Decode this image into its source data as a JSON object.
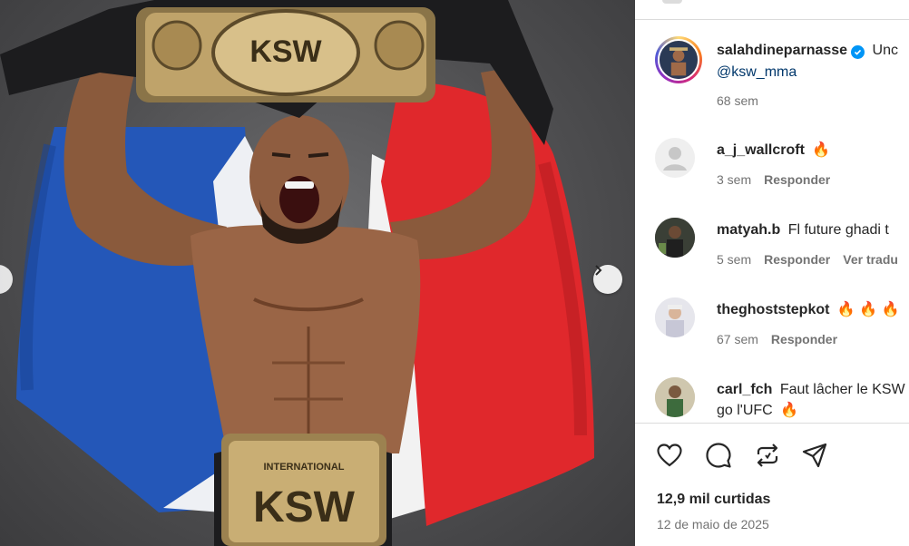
{
  "post": {
    "image_alt_icon": "fighter-with-championship-belt-photo",
    "belt_text_top": "KSW",
    "belt_text_bottom": "KSW",
    "belt_label_small": "INTERNATIONAL",
    "brand_color": "#0095f6"
  },
  "author": {
    "username": "salahdineparnasse",
    "caption_text": "Unc",
    "mention": "@ksw_mma",
    "time": "68 sem",
    "verified": true
  },
  "comments": [
    {
      "username": "a_j_wallcroft",
      "text": "",
      "emoji": "🔥",
      "time": "3 sem",
      "reply_label": "Responder",
      "extra": "",
      "avatar": "default-avatar-icon"
    },
    {
      "username": "matyah.b",
      "text": "Fl future ghadi t",
      "emoji": "",
      "time": "5 sem",
      "reply_label": "Responder",
      "extra": "Ver tradu",
      "avatar": "user-photo"
    },
    {
      "username": "theghoststepkot",
      "text": "",
      "emoji": "🔥 🔥 🔥",
      "time": "67 sem",
      "reply_label": "Responder",
      "extra": "",
      "avatar": "user-photo"
    },
    {
      "username": "carl_fch",
      "text": "Faut lâcher le KSW",
      "text2": "go l'UFC",
      "emoji": "🔥",
      "time": "",
      "reply_label": "",
      "extra": "",
      "avatar": "user-photo"
    }
  ],
  "actions": {
    "like_icon": "heart-icon",
    "comment_icon": "comment-icon",
    "share_icon": "repost-icon",
    "send_icon": "send-icon"
  },
  "stats": {
    "likes": "12,9 mil curtidas",
    "date": "12 de maio de 2025"
  }
}
